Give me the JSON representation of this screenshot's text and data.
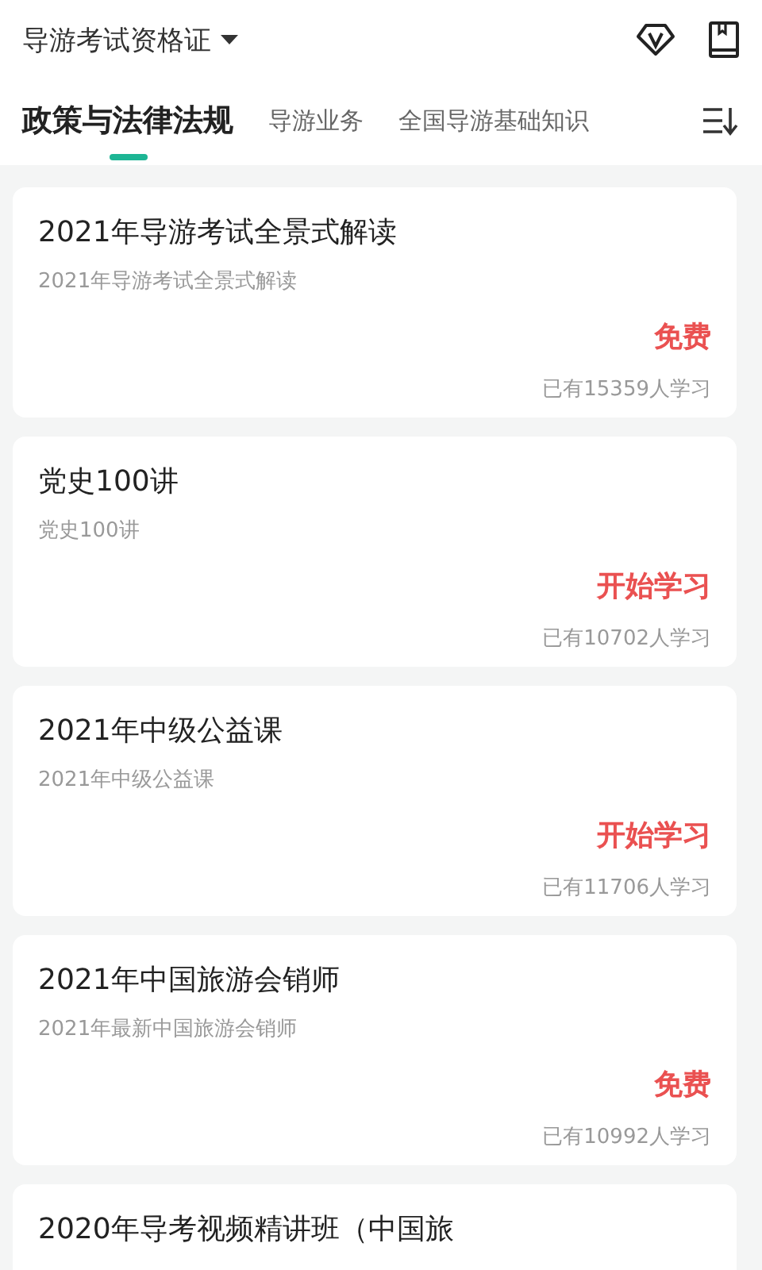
{
  "header": {
    "title": "导游考试资格证"
  },
  "tabs": [
    {
      "label": "政策与法律法规",
      "selected": true
    },
    {
      "label": "导游业务",
      "selected": false
    },
    {
      "label": "全国导游基础知识",
      "selected": false
    }
  ],
  "courses": [
    {
      "title": "2021年导游考试全景式解读",
      "subtitle": "2021年导游考试全景式解读",
      "price": "免费",
      "learners": "已有15359人学习"
    },
    {
      "title": "党史100讲",
      "subtitle": "党史100讲",
      "price": "开始学习",
      "learners": "已有10702人学习"
    },
    {
      "title": "2021年中级公益课",
      "subtitle": "2021年中级公益课",
      "price": "开始学习",
      "learners": "已有11706人学习"
    },
    {
      "title": "2021年中国旅游会销师",
      "subtitle": "2021年最新中国旅游会销师",
      "price": "免费",
      "learners": "已有10992人学习"
    },
    {
      "title": "2020年导考视频精讲班（中国旅"
    }
  ]
}
